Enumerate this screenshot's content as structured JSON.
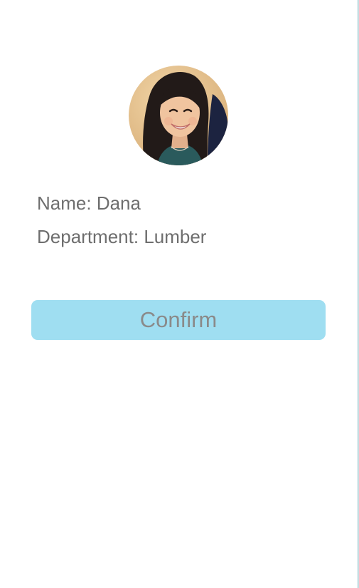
{
  "profile": {
    "name_label": "Name:",
    "name_value": "Dana",
    "department_label": "Department:",
    "department_value": "Lumber"
  },
  "actions": {
    "confirm_label": "Confirm"
  },
  "colors": {
    "button_background": "#9fdef1",
    "label_text": "#6e6e6e",
    "button_text": "#8a8a8a",
    "right_edge": "#b9d8dd"
  },
  "icons": {
    "avatar": "user-photo"
  }
}
